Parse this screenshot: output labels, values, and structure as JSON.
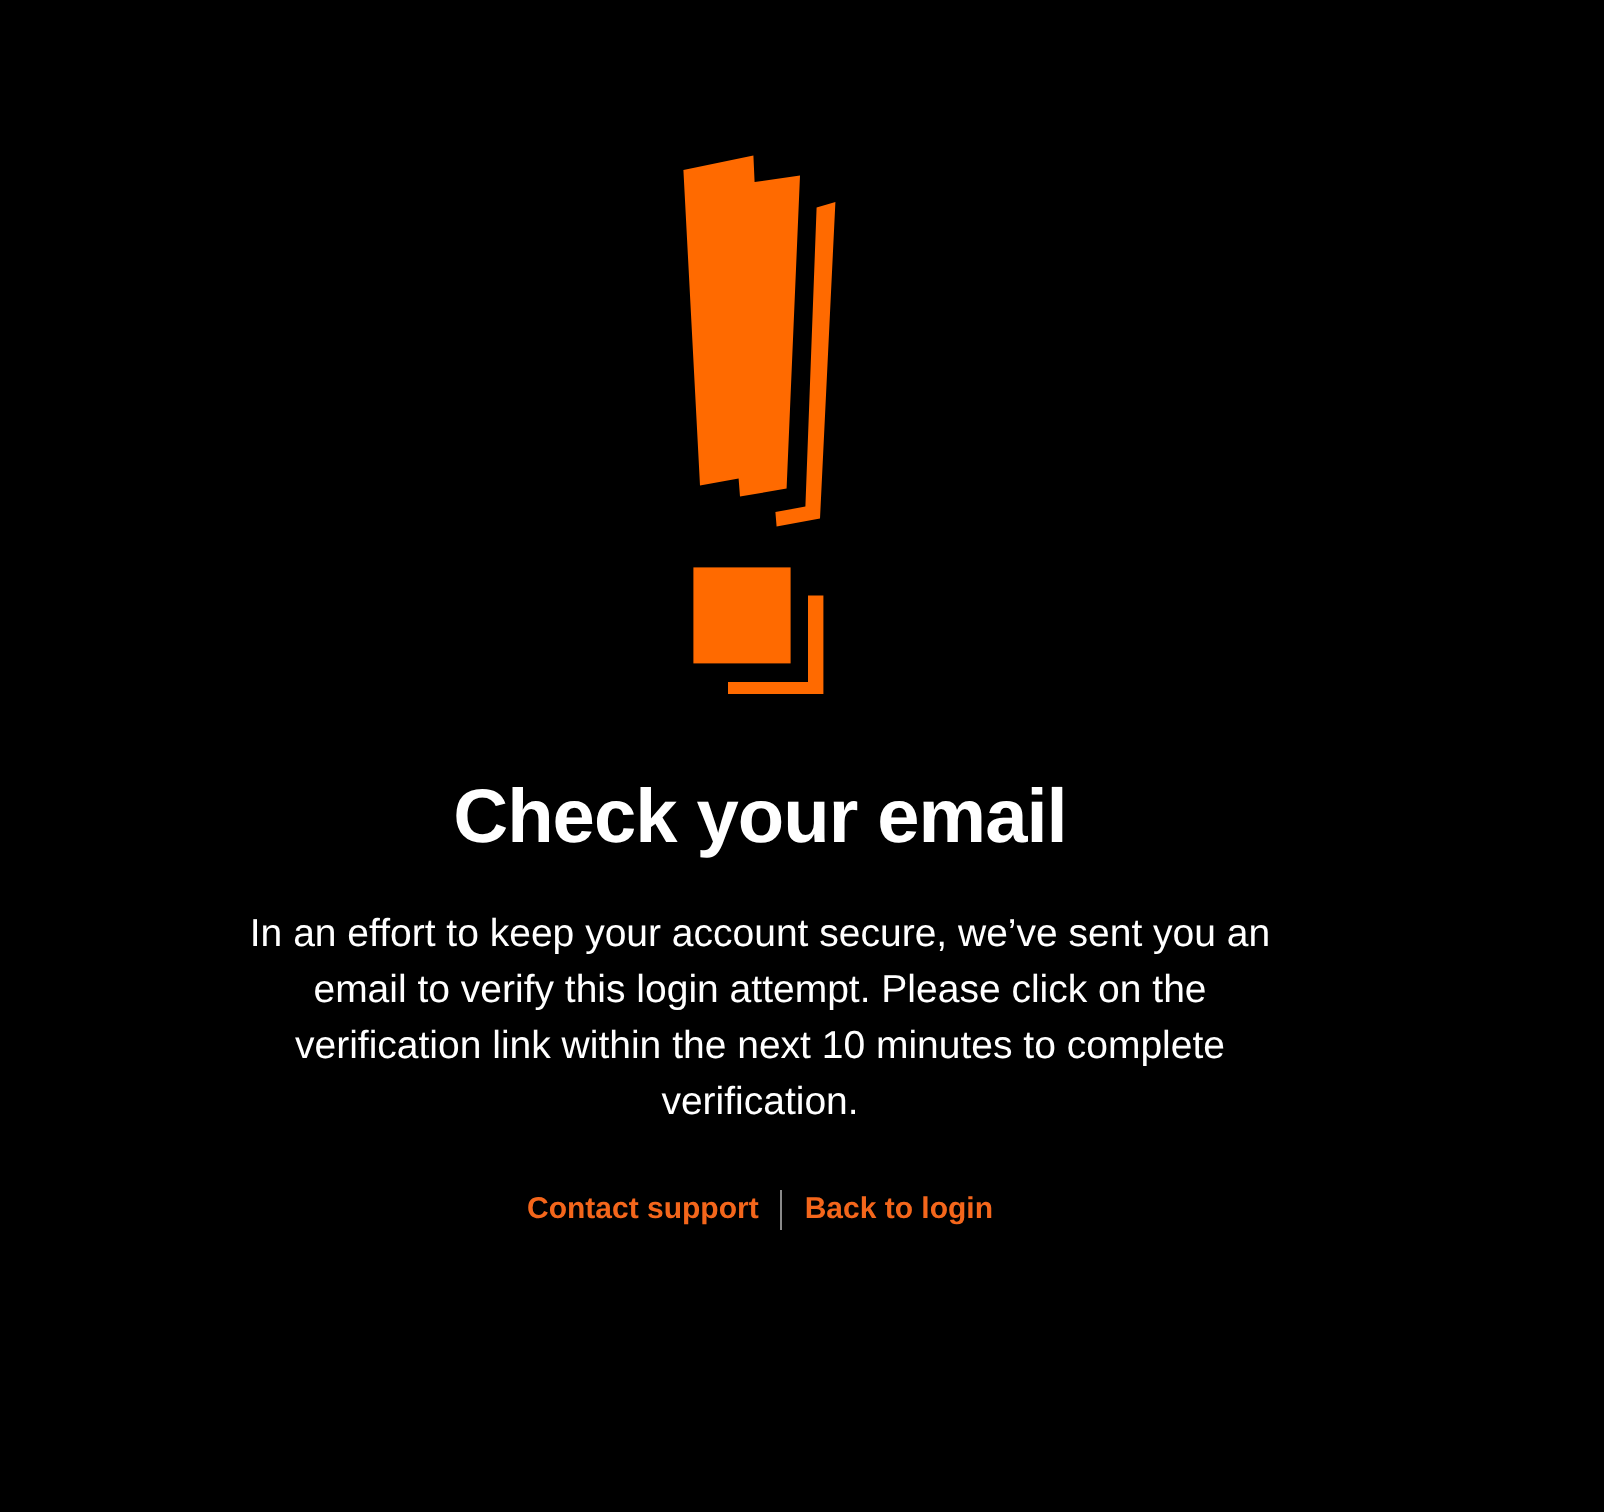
{
  "heading": "Check your email",
  "message": "In an effort to keep your account secure, we’ve sent you an email to verify this login attempt. Please click on the verification link within the next 10 minutes to complete verification.",
  "links": [
    {
      "label": "Contact support"
    },
    {
      "label": "Back to login"
    }
  ]
}
